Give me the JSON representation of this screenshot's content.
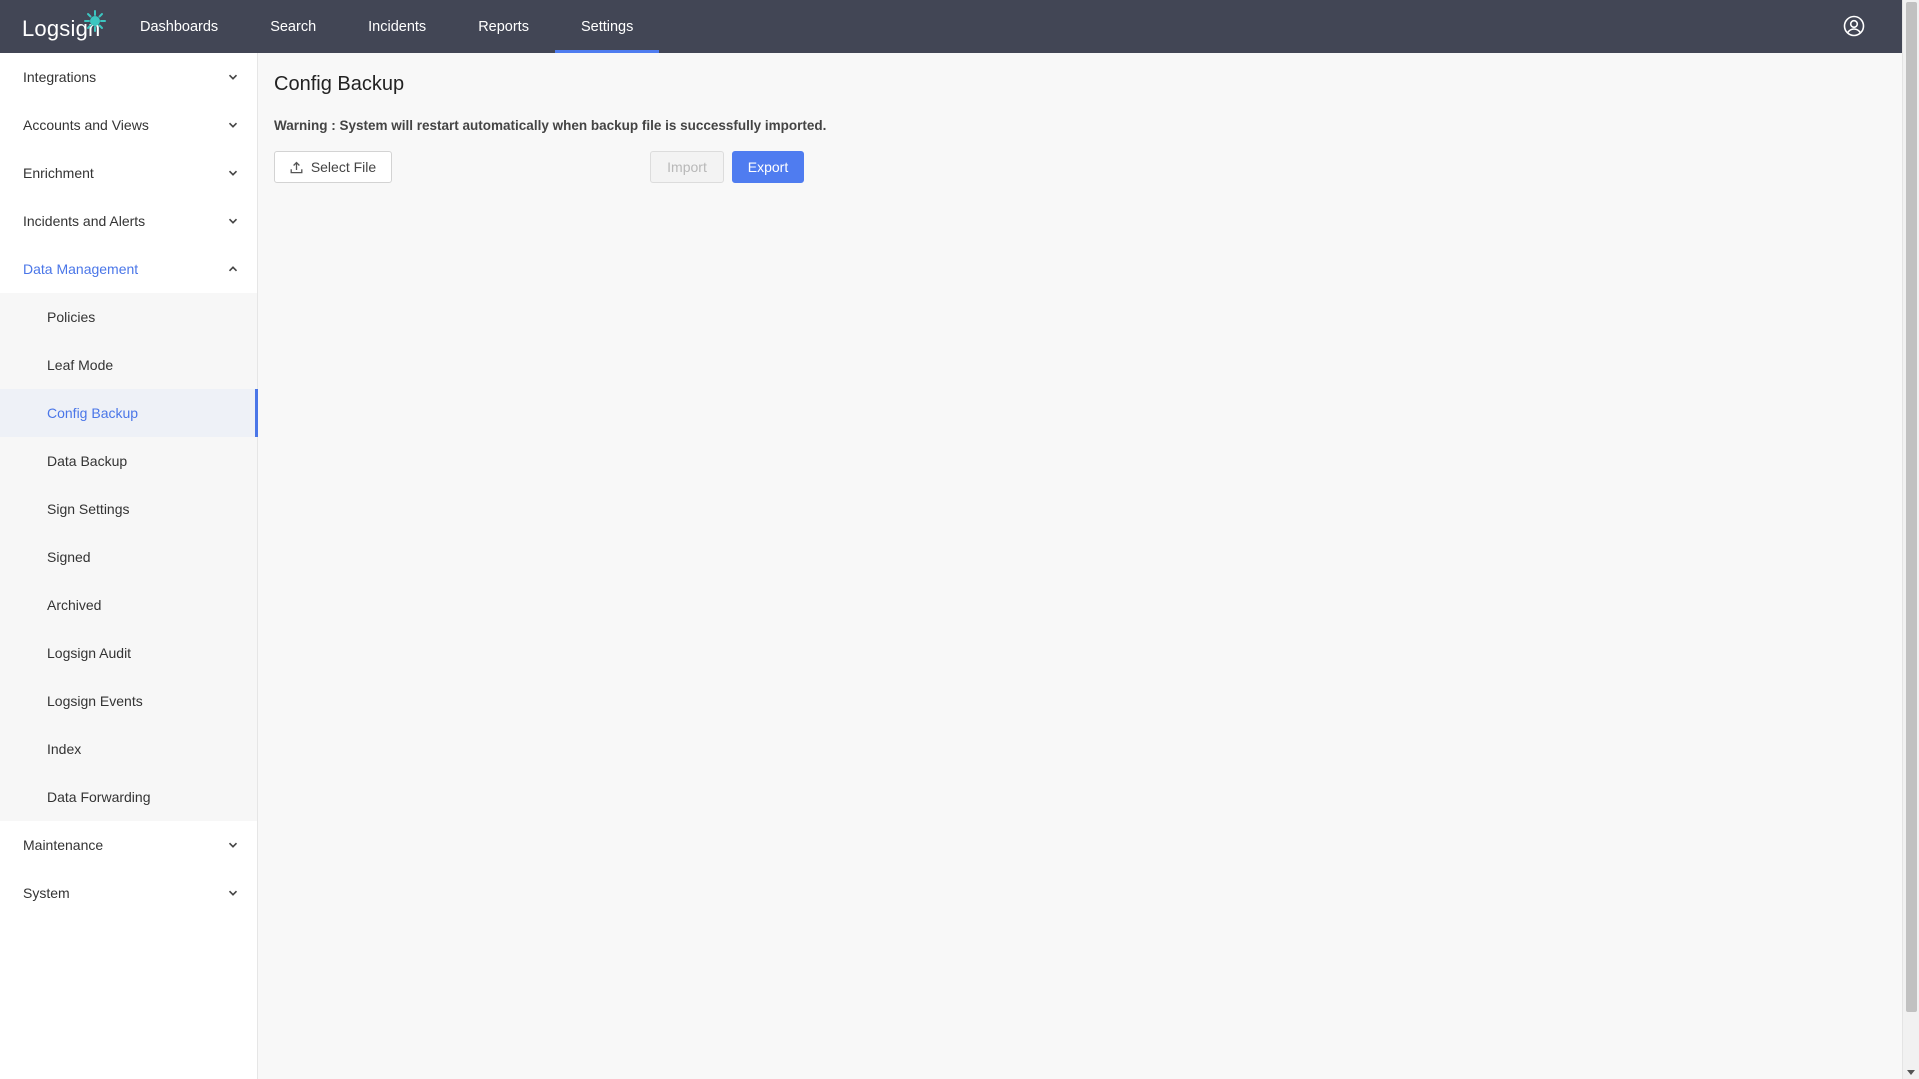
{
  "app": {
    "logo_text": "Logsign"
  },
  "nav": {
    "items": [
      {
        "label": "Dashboards"
      },
      {
        "label": "Search"
      },
      {
        "label": "Incidents"
      },
      {
        "label": "Reports"
      },
      {
        "label": "Settings"
      }
    ],
    "active": "Settings"
  },
  "sidebar": {
    "sections": [
      {
        "label": "Integrations"
      },
      {
        "label": "Accounts and Views"
      },
      {
        "label": "Enrichment"
      },
      {
        "label": "Incidents and Alerts"
      },
      {
        "label": "Data Management"
      },
      {
        "label": "Maintenance"
      },
      {
        "label": "System"
      }
    ],
    "data_management_items": [
      {
        "label": "Policies"
      },
      {
        "label": "Leaf Mode"
      },
      {
        "label": "Config Backup"
      },
      {
        "label": "Data Backup"
      },
      {
        "label": "Sign Settings"
      },
      {
        "label": "Signed"
      },
      {
        "label": "Archived"
      },
      {
        "label": "Logsign Audit"
      },
      {
        "label": "Logsign Events"
      },
      {
        "label": "Index"
      },
      {
        "label": "Data Forwarding"
      }
    ],
    "active_item": "Config Backup"
  },
  "main": {
    "title": "Config Backup",
    "warning": "Warning : System will restart automatically when backup file is successfully imported.",
    "select_file_label": "Select File",
    "import_label": "Import",
    "export_label": "Export"
  },
  "colors": {
    "topbar": "#424655",
    "accent": "#4f7cf0",
    "active_text": "#4a76e8"
  }
}
